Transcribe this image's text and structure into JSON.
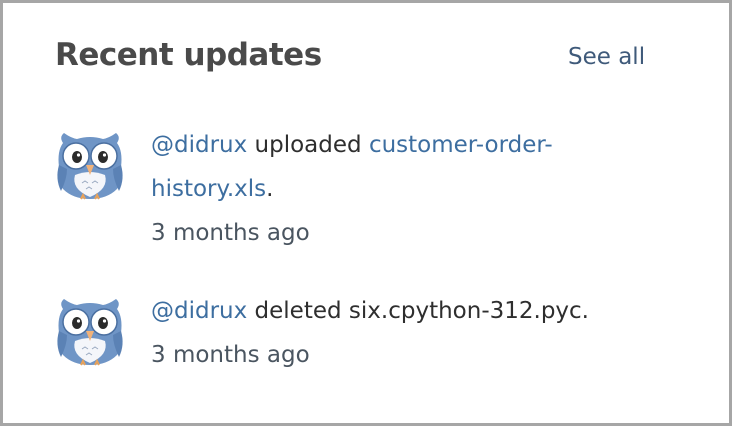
{
  "panel": {
    "title": "Recent updates",
    "see_all_label": "See all"
  },
  "updates": [
    {
      "avatar_icon": "owl-avatar-icon",
      "user": "@didrux",
      "action": "uploaded",
      "object_line1": "customer-order-",
      "object_line2": "history.xls",
      "period": ".",
      "time": "3 months ago"
    },
    {
      "avatar_icon": "owl-avatar-icon",
      "user": "@didrux",
      "action": "deleted",
      "object": "six.cpython-312.pyc.",
      "time": "3 months ago"
    }
  ],
  "colors": {
    "link": "#3d6ea0",
    "title": "#4a4a4a",
    "see_all": "#3f5a7a",
    "owl_body": "#6f95c6"
  }
}
